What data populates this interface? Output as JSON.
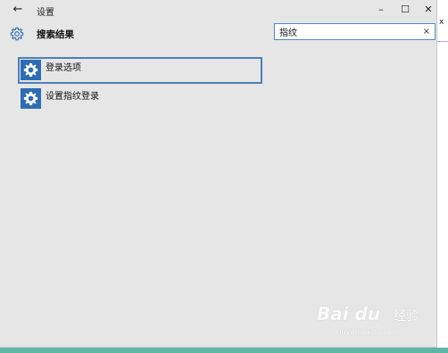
{
  "window": {
    "title": "设置",
    "back_icon": "arrow-left-icon",
    "controls": {
      "minimize": "–",
      "maximize": "☐",
      "close": "✕"
    }
  },
  "header": {
    "icon": "gear-icon",
    "title": "搜索结果"
  },
  "search": {
    "value": "指纹",
    "clear_icon": "close-icon",
    "clear_glyph": "×"
  },
  "results": [
    {
      "label": "登录选项",
      "icon": "gear-icon",
      "selected": true
    },
    {
      "label": "设置指纹登录",
      "icon": "gear-icon",
      "selected": false
    }
  ],
  "watermark": {
    "logo": "Bai du",
    "brand": "经验",
    "url": "jingyan.baidu.com"
  },
  "colors": {
    "window_bg": "#e6e6e6",
    "accent": "#2d6db5",
    "selection_border": "#4e7fb8",
    "search_border": "#4a8ad0",
    "taskbar": "#5fb6a6"
  }
}
